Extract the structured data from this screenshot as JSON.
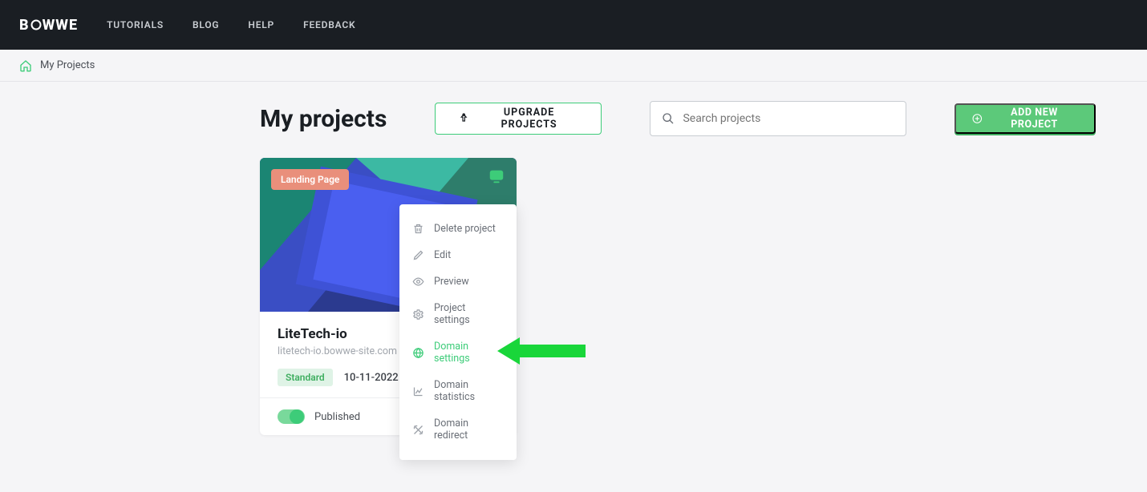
{
  "brand": "BOWWE",
  "nav": {
    "items": [
      {
        "label": "TUTORIALS"
      },
      {
        "label": "BLOG"
      },
      {
        "label": "HELP"
      },
      {
        "label": "FEEDBACK"
      }
    ]
  },
  "breadcrumb": {
    "label": "My Projects"
  },
  "page": {
    "title": "My projects"
  },
  "actions": {
    "upgrade_label": "UPGRADE PROJECTS",
    "add_label": "ADD NEW PROJECT"
  },
  "search": {
    "placeholder": "Search projects"
  },
  "project_card": {
    "badge": "Landing Page",
    "name": "LiteTech-io",
    "url": "litetech-io.bowwe-site.com",
    "plan": "Standard",
    "date": "10-11-2022",
    "status": "Published"
  },
  "context_menu": {
    "items": [
      {
        "label": "Delete project",
        "icon": "trash-icon"
      },
      {
        "label": "Edit",
        "icon": "pencil-icon"
      },
      {
        "label": "Preview",
        "icon": "eye-icon"
      },
      {
        "label": "Project settings",
        "icon": "gear-icon"
      },
      {
        "label": "Domain settings",
        "icon": "globe-icon",
        "active": true
      },
      {
        "label": "Domain statistics",
        "icon": "stats-icon"
      },
      {
        "label": "Domain redirect",
        "icon": "redirect-icon"
      }
    ]
  }
}
